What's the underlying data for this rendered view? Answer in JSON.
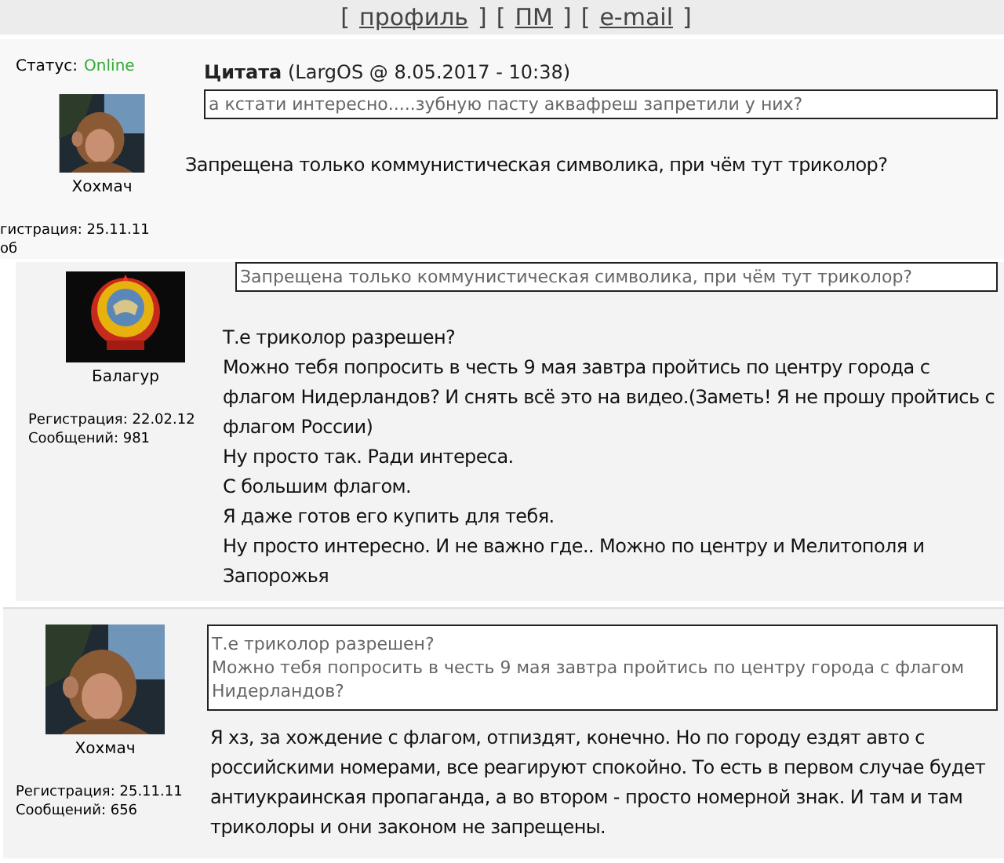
{
  "nav_links": [
    {
      "open": "[",
      "label": "профиль",
      "close": "]"
    },
    {
      "open": "[",
      "label": "ПМ",
      "close": "]"
    },
    {
      "open": "[",
      "label": "e-mail",
      "close": "]"
    }
  ],
  "posts": [
    {
      "status_label": "Статус:",
      "status": "Online",
      "online": true,
      "avatar": {
        "kind": "picture"
      },
      "username": "Хохмач",
      "meta": [
        "гистрация: 25.11.11",
        "об"
      ],
      "quote_header": "**Цитата** (LargOS @ 8.05.2017 - 10:38)",
      "quote": [
        "а кстати интересно.....зубную пасту аквафреш запретили у них?"
      ],
      "body": [
        "Запрещена только коммунистическая символика, при чём тут триколор?"
      ]
    },
    {
      "avatar": {
        "kind": "picture"
      },
      "username": "Балагур",
      "meta": [
        "Регистрация: 22.02.12",
        "Сообщений: 981"
      ],
      "quote": [
        "Запрещена только коммунистическая символика, при чём тут триколор?"
      ],
      "body": [
        "Т.е триколор разрешен?",
        "Можно тебя попросить в честь 9 мая завтра пройтись по центру города с флагом Нидерландов? И снять всё это на видео.(Заметь! Я не прошу пройтись с флагом России)",
        "Ну просто так. Ради интереса.",
        "С большим флагом.",
        "Я даже готов его купить для тебя.",
        "Ну просто интересно. И не важно где.. Можно по центру и Мелитополя и Запорожья"
      ]
    },
    {
      "avatar": {
        "kind": "picture"
      },
      "username": "Хохмач",
      "meta": [
        "Регистрация: 25.11.11",
        "Сообщений: 656"
      ],
      "quote": [
        "Т.е триколор разрешен?",
        "Можно тебя попросить в честь 9 мая завтра пройтись по центру города с флагом Нидерландов?"
      ],
      "body": [
        "Я хз, за хождение с флагом, отпиздят, конечно. Но по городу ездят авто с российскими номерами, все реагируют спокойно. То есть в первом случае будет антиукраинская пропаганда, а во втором - просто номерной знак. И там и там триколоры и они законом не запрещены."
      ]
    }
  ]
}
